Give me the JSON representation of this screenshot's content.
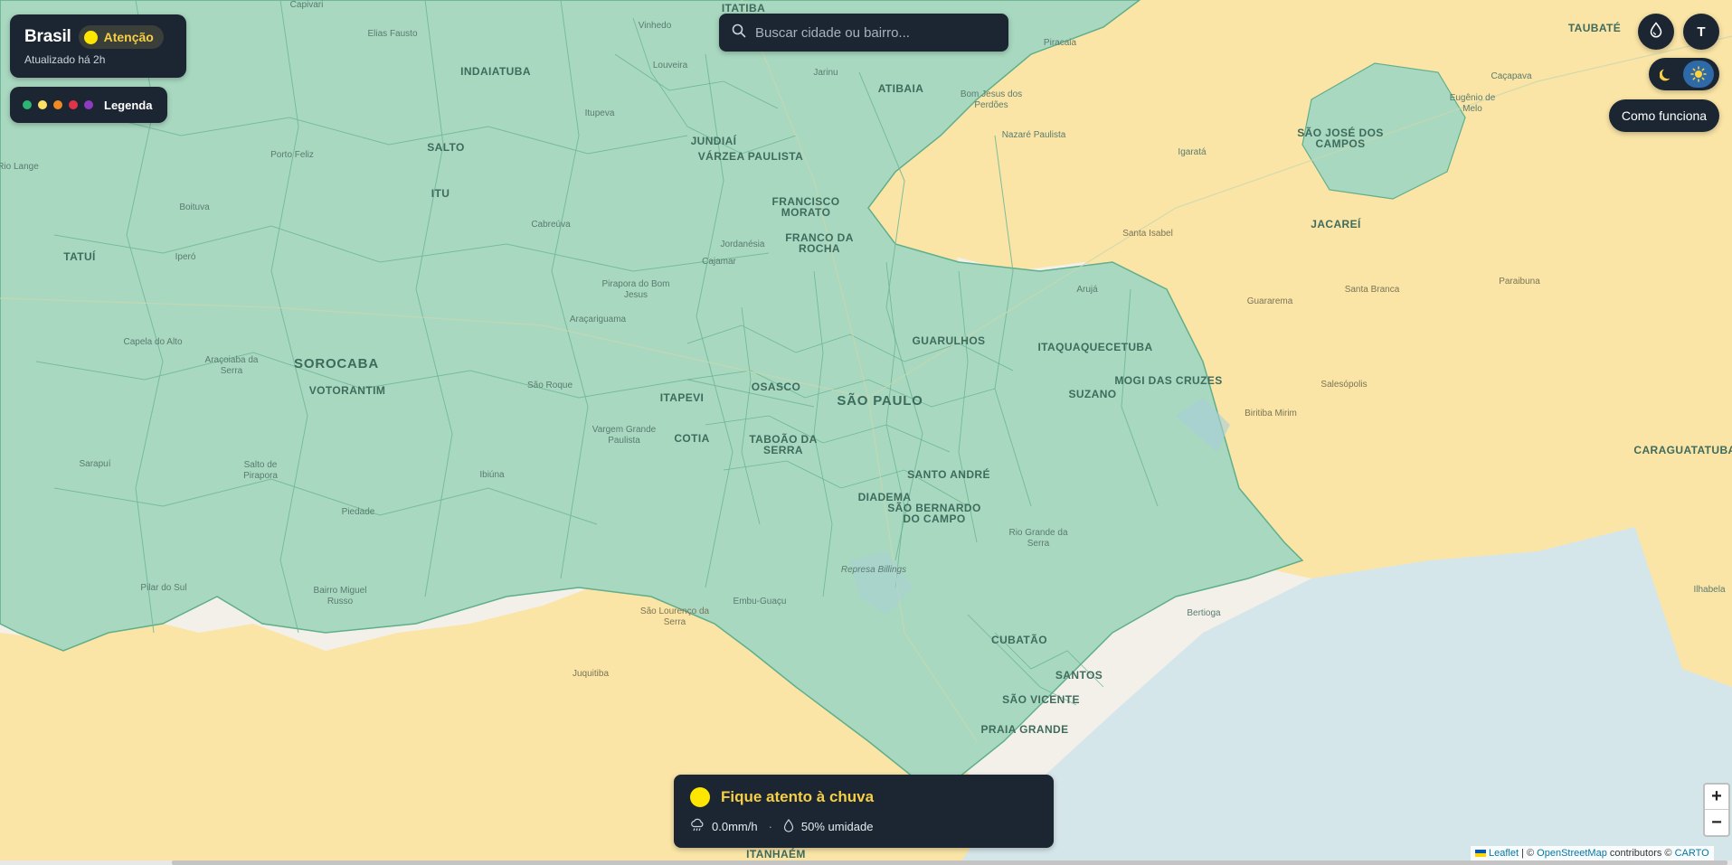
{
  "region": {
    "name": "Brasil",
    "status": "Atenção",
    "updated": "Atualizado há 2h"
  },
  "legend": {
    "label": "Legenda",
    "colors": [
      "#2bb673",
      "#ffe066",
      "#f08a24",
      "#e0344a",
      "#8e3bbf"
    ]
  },
  "search": {
    "placeholder": "Buscar cidade ou bairro..."
  },
  "top_right": {
    "avatar_initial": "T",
    "howto_label": "Como funciona",
    "theme_icons": [
      "moon-icon",
      "sun-icon"
    ],
    "rain_icon": "droplet-icon"
  },
  "alert": {
    "title": "Fique atento à chuva",
    "rain": "0.0mm/h",
    "separator": "·",
    "humidity": "50% umidade",
    "status_color": "#ffe600"
  },
  "zoom": {
    "in": "+",
    "out": "−"
  },
  "attribution": {
    "leaflet": "Leaflet",
    "separator": " | © ",
    "osm": "OpenStreetMap",
    "contributors": " contributors © ",
    "carto": "CARTO"
  },
  "map_colors": {
    "green_zone": "#a8d8c0",
    "green_border": "#5fae8c",
    "yellow_zone": "#fae5a6",
    "sea": "#d5e6ea",
    "land": "#f3f0ea"
  },
  "map_labels": [
    {
      "text": "Capivari",
      "cls": "small"
    },
    {
      "text": "Elias Fausto",
      "cls": "small"
    },
    {
      "text": "Vinhedo",
      "cls": "small"
    },
    {
      "text": "ITATIBA",
      "cls": "city"
    },
    {
      "text": "Piracaia",
      "cls": "small"
    },
    {
      "text": "TAUBATÉ",
      "cls": "city"
    },
    {
      "text": "INDAIATUBA",
      "cls": "city"
    },
    {
      "text": "Louveira",
      "cls": "small"
    },
    {
      "text": "Jarinu",
      "cls": "small"
    },
    {
      "text": "ATIBAIA",
      "cls": "city"
    },
    {
      "text": "Bom Jesus dos Perdões",
      "cls": "small"
    },
    {
      "text": "Caçapava",
      "cls": "small"
    },
    {
      "text": "Itupeva",
      "cls": "small"
    },
    {
      "text": "JUNDIAÍ",
      "cls": "city"
    },
    {
      "text": "VÁRZEA PAULISTA",
      "cls": "city"
    },
    {
      "text": "Nazaré Paulista",
      "cls": "small"
    },
    {
      "text": "Eugênio de Melo",
      "cls": "small"
    },
    {
      "text": "SALTO",
      "cls": "city"
    },
    {
      "text": "Porto Feliz",
      "cls": "small"
    },
    {
      "text": "Igaratá",
      "cls": "small"
    },
    {
      "text": "SÃO JOSÉ DOS CAMPOS",
      "cls": "city"
    },
    {
      "text": "Rio Lange",
      "cls": "small"
    },
    {
      "text": "ITU",
      "cls": "city"
    },
    {
      "text": "FRANCISCO MORATO",
      "cls": "city"
    },
    {
      "text": "Boituva",
      "cls": "small"
    },
    {
      "text": "Cabreúva",
      "cls": "small"
    },
    {
      "text": "JACAREÍ",
      "cls": "city"
    },
    {
      "text": "Santa Isabel",
      "cls": "small"
    },
    {
      "text": "FRANCO DA ROCHA",
      "cls": "city"
    },
    {
      "text": "Jordanésia",
      "cls": "small"
    },
    {
      "text": "TATUÍ",
      "cls": "city"
    },
    {
      "text": "Iperó",
      "cls": "small"
    },
    {
      "text": "Cajamar",
      "cls": "small"
    },
    {
      "text": "Pirapora do Bom Jesus",
      "cls": "small"
    },
    {
      "text": "Arujá",
      "cls": "small"
    },
    {
      "text": "Paraibuna",
      "cls": "small"
    },
    {
      "text": "Guararema",
      "cls": "small"
    },
    {
      "text": "Santa Branca",
      "cls": "small"
    },
    {
      "text": "Araçariguama",
      "cls": "small"
    },
    {
      "text": "Capela do Alto",
      "cls": "small"
    },
    {
      "text": "GUARULHOS",
      "cls": "city"
    },
    {
      "text": "ITAQUAQUECETUBA",
      "cls": "city"
    },
    {
      "text": "SOROCABA",
      "cls": "major"
    },
    {
      "text": "Araçoiaba da Serra",
      "cls": "small"
    },
    {
      "text": "VOTORANTIM",
      "cls": "city"
    },
    {
      "text": "São Roque",
      "cls": "small"
    },
    {
      "text": "OSASCO",
      "cls": "city"
    },
    {
      "text": "MOGI DAS CRUZES",
      "cls": "city"
    },
    {
      "text": "Salesópolis",
      "cls": "small"
    },
    {
      "text": "ITAPEVI",
      "cls": "city"
    },
    {
      "text": "SÃO PAULO",
      "cls": "major"
    },
    {
      "text": "SUZANO",
      "cls": "city"
    },
    {
      "text": "Biritiba Mirim",
      "cls": "small"
    },
    {
      "text": "Vargem Grande Paulista",
      "cls": "small"
    },
    {
      "text": "COTIA",
      "cls": "city"
    },
    {
      "text": "TABOÃO DA SERRA",
      "cls": "city"
    },
    {
      "text": "CARAGUATATUBA",
      "cls": "city"
    },
    {
      "text": "Sarapuí",
      "cls": "small"
    },
    {
      "text": "Salto de Pirapora",
      "cls": "small"
    },
    {
      "text": "Ibiúna",
      "cls": "small"
    },
    {
      "text": "SANTO ANDRÉ",
      "cls": "city"
    },
    {
      "text": "DIADEMA",
      "cls": "city"
    },
    {
      "text": "SÃO BERNARDO DO CAMPO",
      "cls": "city"
    },
    {
      "text": "Piedade",
      "cls": "small"
    },
    {
      "text": "Rio Grande da Serra",
      "cls": "small"
    },
    {
      "text": "Represa Billings",
      "cls": "small"
    },
    {
      "text": "Pilar do Sul",
      "cls": "small"
    },
    {
      "text": "Bairro Miguel Russo",
      "cls": "small"
    },
    {
      "text": "Embu-Guaçu",
      "cls": "small"
    },
    {
      "text": "São Lourenço da Serra",
      "cls": "small"
    },
    {
      "text": "Bertioga",
      "cls": "small"
    },
    {
      "text": "Ilhabela",
      "cls": "small"
    },
    {
      "text": "CUBATÃO",
      "cls": "city"
    },
    {
      "text": "Juquitiba",
      "cls": "small"
    },
    {
      "text": "SANTOS",
      "cls": "city"
    },
    {
      "text": "SÃO VICENTE",
      "cls": "city"
    },
    {
      "text": "PRAIA GRANDE",
      "cls": "city"
    },
    {
      "text": "ITANHAÉM",
      "cls": "city"
    }
  ]
}
